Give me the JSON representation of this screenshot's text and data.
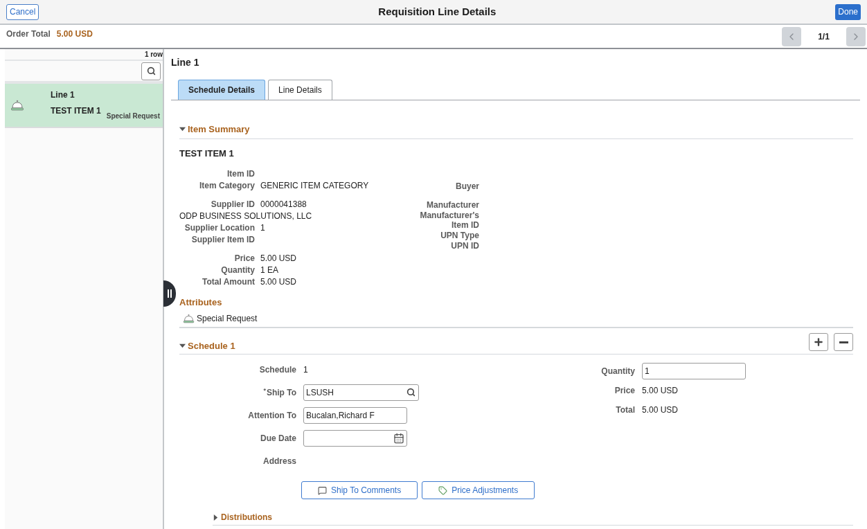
{
  "header": {
    "cancel": "Cancel",
    "title": "Requisition Line Details",
    "done": "Done"
  },
  "order_total": {
    "label": "Order Total",
    "value": "5.00 USD"
  },
  "pager": {
    "text": "1/1",
    "prev_disabled": true,
    "next_disabled": true
  },
  "sidebar": {
    "row_count": "1 row",
    "items": [
      {
        "line": "Line 1",
        "item": "TEST ITEM 1",
        "tag": "Special Request",
        "selected": true
      }
    ]
  },
  "line_title": "Line 1",
  "tabs": [
    {
      "label": "Schedule Details",
      "selected": true
    },
    {
      "label": "Line Details",
      "selected": false
    }
  ],
  "item_summary": {
    "heading": "Item Summary",
    "expanded": true,
    "item_name": "TEST ITEM 1",
    "left_groups": [
      [
        {
          "kind": "field",
          "label": "Item ID"
        },
        {
          "kind": "field",
          "label": "Item Category",
          "value": "GENERIC ITEM CATEGORY"
        }
      ],
      [
        {
          "kind": "field",
          "label": "Supplier ID",
          "value": "0000041388"
        },
        {
          "kind": "full",
          "text": "ODP BUSINESS SOLUTIONS, LLC"
        },
        {
          "kind": "field",
          "label": "Supplier Location",
          "value": "1"
        },
        {
          "kind": "field",
          "label": "Supplier Item ID"
        }
      ],
      [
        {
          "kind": "field",
          "label": "Price",
          "value": "5.00 USD"
        },
        {
          "kind": "field",
          "label": "Quantity",
          "value": "1 EA"
        },
        {
          "kind": "field",
          "label": "Total Amount",
          "value": "5.00 USD"
        }
      ]
    ],
    "right_groups": [
      [
        "Buyer"
      ],
      [
        "Manufacturer",
        "Manufacturer's Item ID",
        "UPN Type",
        "UPN ID"
      ]
    ],
    "attributes_heading": "Attributes",
    "attributes": [
      "Special Request"
    ]
  },
  "schedule": {
    "heading": "Schedule 1",
    "expanded": true,
    "left_fields": [
      {
        "kind": "text",
        "label": "Schedule",
        "value": "1"
      },
      {
        "kind": "lookup",
        "label": "Ship To",
        "required_mark": "*",
        "value": "LSUSH"
      },
      {
        "kind": "input",
        "label": "Attention To",
        "value": "Bucalan,Richard F"
      },
      {
        "kind": "date",
        "label": "Due Date"
      },
      {
        "kind": "text",
        "label": "Address"
      }
    ],
    "right_fields": [
      {
        "kind": "input",
        "label": "Quantity",
        "value": "1"
      },
      {
        "kind": "text",
        "label": "Price",
        "value": "5.00 USD"
      },
      {
        "kind": "text",
        "label": "Total",
        "value": "5.00 USD"
      }
    ],
    "buttons": [
      {
        "kind": "comment",
        "label": "Ship To Comments"
      },
      {
        "kind": "tag",
        "label": "Price Adjustments"
      }
    ],
    "distributions": {
      "heading": "Distributions",
      "expanded": false
    }
  }
}
